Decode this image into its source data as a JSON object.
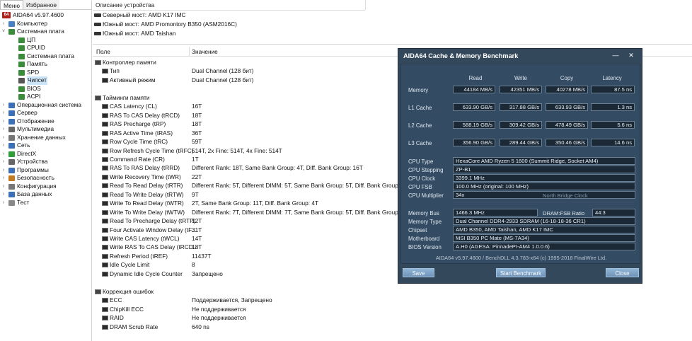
{
  "left": {
    "tabs": [
      "Меню",
      "Избранное"
    ],
    "app_version": "AIDA64 v5.97.4600",
    "tree": [
      {
        "label": "Компьютер",
        "level": 1,
        "exp": "›",
        "color": "#4a7fc1"
      },
      {
        "label": "Системная плата",
        "level": 1,
        "exp": "˅",
        "color": "#3a8b3a"
      },
      {
        "label": "ЦП",
        "level": 2,
        "exp": "",
        "color": "#3a8b3a"
      },
      {
        "label": "CPUID",
        "level": 2,
        "exp": "",
        "color": "#3a8b3a"
      },
      {
        "label": "Системная плата",
        "level": 2,
        "exp": "",
        "color": "#3a8b3a"
      },
      {
        "label": "Память",
        "level": 2,
        "exp": "",
        "color": "#3a8b3a"
      },
      {
        "label": "SPD",
        "level": 2,
        "exp": "",
        "color": "#3a8b3a"
      },
      {
        "label": "Чипсет",
        "level": 2,
        "exp": "",
        "color": "#555555",
        "selected": true
      },
      {
        "label": "BIOS",
        "level": 2,
        "exp": "",
        "color": "#3a8b3a"
      },
      {
        "label": "ACPI",
        "level": 2,
        "exp": "",
        "color": "#3a8b3a"
      },
      {
        "label": "Операционная система",
        "level": 1,
        "exp": "›",
        "color": "#3b6fb8"
      },
      {
        "label": "Сервер",
        "level": 1,
        "exp": "›",
        "color": "#3b6fb8"
      },
      {
        "label": "Отображение",
        "level": 1,
        "exp": "›",
        "color": "#3b6fb8"
      },
      {
        "label": "Мультимедиа",
        "level": 1,
        "exp": "›",
        "color": "#666666"
      },
      {
        "label": "Хранение данных",
        "level": 1,
        "exp": "›",
        "color": "#777777"
      },
      {
        "label": "Сеть",
        "level": 1,
        "exp": "›",
        "color": "#3b6fb8"
      },
      {
        "label": "DirectX",
        "level": 1,
        "exp": "›",
        "color": "#2f9e3a"
      },
      {
        "label": "Устройства",
        "level": 1,
        "exp": "›",
        "color": "#666666"
      },
      {
        "label": "Программы",
        "level": 1,
        "exp": "›",
        "color": "#3b6fb8"
      },
      {
        "label": "Безопасность",
        "level": 1,
        "exp": "›",
        "color": "#c47a20"
      },
      {
        "label": "Конфигурация",
        "level": 1,
        "exp": "›",
        "color": "#777777"
      },
      {
        "label": "База данных",
        "level": 1,
        "exp": "›",
        "color": "#3b6fb8"
      },
      {
        "label": "Тест",
        "level": 1,
        "exp": "›",
        "color": "#888888"
      }
    ]
  },
  "top": {
    "header": "Описание устройства",
    "devices": [
      "Северный мост: AMD K17 IMC",
      "Южный мост: AMD Promontory B350 (ASM2016C)",
      "Южный мост: AMD Taishan"
    ]
  },
  "list": {
    "col_field": "Поле",
    "col_value": "Значение",
    "rows": [
      {
        "type": "group",
        "k": "Контроллер памяти",
        "v": ""
      },
      {
        "type": "item",
        "k": "Тип",
        "v": "Dual Channel  (128 бит)"
      },
      {
        "type": "item",
        "k": "Активный режим",
        "v": "Dual Channel  (128 бит)"
      },
      {
        "type": "blank",
        "k": "",
        "v": ""
      },
      {
        "type": "group",
        "k": "Тайминги памяти",
        "v": ""
      },
      {
        "type": "item",
        "k": "CAS Latency (CL)",
        "v": "16T"
      },
      {
        "type": "item",
        "k": "RAS To CAS Delay (tRCD)",
        "v": "18T"
      },
      {
        "type": "item",
        "k": "RAS Precharge (tRP)",
        "v": "18T"
      },
      {
        "type": "item",
        "k": "RAS Active Time (tRAS)",
        "v": "36T"
      },
      {
        "type": "item",
        "k": "Row Cycle Time (tRC)",
        "v": "59T"
      },
      {
        "type": "item",
        "k": "Row Refresh Cycle Time (tRFC)",
        "v": "514T, 2x Fine: 514T, 4x Fine: 514T"
      },
      {
        "type": "item",
        "k": "Command Rate (CR)",
        "v": "1T"
      },
      {
        "type": "item",
        "k": "RAS To RAS Delay (tRRD)",
        "v": "Different Rank: 18T, Same Bank Group: 4T, Diff. Bank Group: 16T"
      },
      {
        "type": "item",
        "k": "Write Recovery Time (tWR)",
        "v": "22T"
      },
      {
        "type": "item",
        "k": "Read To Read Delay (tRTR)",
        "v": "Different Rank: 5T, Different DIMM: 5T, Same Bank Group: 5T, Diff. Bank Group: 1T"
      },
      {
        "type": "item",
        "k": "Read To Write Delay (tRTW)",
        "v": "9T"
      },
      {
        "type": "item",
        "k": "Write To Read Delay (tWTR)",
        "v": "2T, Same Bank Group: 11T, Diff. Bank Group: 4T"
      },
      {
        "type": "item",
        "k": "Write To Write Delay (tWTW)",
        "v": "Different Rank: 7T, Different DIMM: 7T, Same Bank Group: 5T, Diff. Bank Group: 1T"
      },
      {
        "type": "item",
        "k": "Read To Precharge Delay (tRTP)",
        "v": "12T"
      },
      {
        "type": "item",
        "k": "Four Activate Window Delay (tF...",
        "v": "31T"
      },
      {
        "type": "item",
        "k": "Write CAS Latency (tWCL)",
        "v": "14T"
      },
      {
        "type": "item",
        "k": "Write RAS To CAS Delay (tRCD...",
        "v": "18T"
      },
      {
        "type": "item",
        "k": "Refresh Period (tREF)",
        "v": "11437T"
      },
      {
        "type": "item",
        "k": "Idle Cycle Limit",
        "v": "8"
      },
      {
        "type": "item",
        "k": "Dynamic Idle Cycle Counter",
        "v": "Запрещено"
      },
      {
        "type": "blank",
        "k": "",
        "v": ""
      },
      {
        "type": "group",
        "k": "Коррекция ошибок",
        "v": ""
      },
      {
        "type": "item",
        "k": "ECC",
        "v": "Поддерживается, Запрещено"
      },
      {
        "type": "item",
        "k": "ChipKill ECC",
        "v": "Не поддерживается"
      },
      {
        "type": "item",
        "k": "RAID",
        "v": "Не поддерживается"
      },
      {
        "type": "item",
        "k": "DRAM Scrub Rate",
        "v": "640 ns"
      }
    ]
  },
  "bench": {
    "title": "AIDA64 Cache & Memory Benchmark",
    "minimize": "—",
    "close_x": "✕",
    "headers": [
      "Read",
      "Write",
      "Copy",
      "Latency"
    ],
    "perf_rows": [
      {
        "label": "Memory",
        "values": [
          "44184 MB/s",
          "42351 MB/s",
          "40278 MB/s",
          "87.5 ns"
        ]
      },
      {
        "label": "L1 Cache",
        "values": [
          "633.90 GB/s",
          "317.88 GB/s",
          "633.93 GB/s",
          "1.3 ns"
        ]
      },
      {
        "label": "L2 Cache",
        "values": [
          "588.19 GB/s",
          "309.42 GB/s",
          "478.49 GB/s",
          "5.6 ns"
        ]
      },
      {
        "label": "L3 Cache",
        "values": [
          "356.90 GB/s",
          "289.44 GB/s",
          "350.46 GB/s",
          "14.6 ns"
        ]
      }
    ],
    "cpu": {
      "type_label": "CPU Type",
      "type": "HexaCore AMD Ryzen 5 1600  (Summit Ridge, Socket AM4)",
      "stepping_label": "CPU Stepping",
      "stepping": "ZP-B1",
      "clock_label": "CPU Clock",
      "clock": "3399.1 MHz",
      "fsb_label": "CPU FSB",
      "fsb": "100.0 MHz  (original: 100 MHz)",
      "mult_label": "CPU Multiplier",
      "mult": "34x",
      "nb_clock_label": "North Bridge Clock"
    },
    "mem": {
      "bus_label": "Memory Bus",
      "bus": "1466.3 MHz",
      "ratio_label": "DRAM:FSB Ratio",
      "ratio": "44:3",
      "type_label": "Memory Type",
      "type": "Dual Channel DDR4-2933 SDRAM  (16-18-18-36 CR1)",
      "chipset_label": "Chipset",
      "chipset": "AMD B350, AMD Taishan, AMD K17 IMC",
      "mb_label": "Motherboard",
      "mb": "MSI B350 PC Mate (MS-7A34)",
      "bios_label": "BIOS Version",
      "bios": "A.H0  (AGESA: PinnadePI-AM4 1.0.0.6)"
    },
    "footer": "AIDA64 v5.97.4600 / BenchDLL 4.3.783-x64  (c) 1995-2018 FinalWire Ltd.",
    "buttons": {
      "save": "Save",
      "start": "Start Benchmark",
      "close": "Close"
    }
  }
}
